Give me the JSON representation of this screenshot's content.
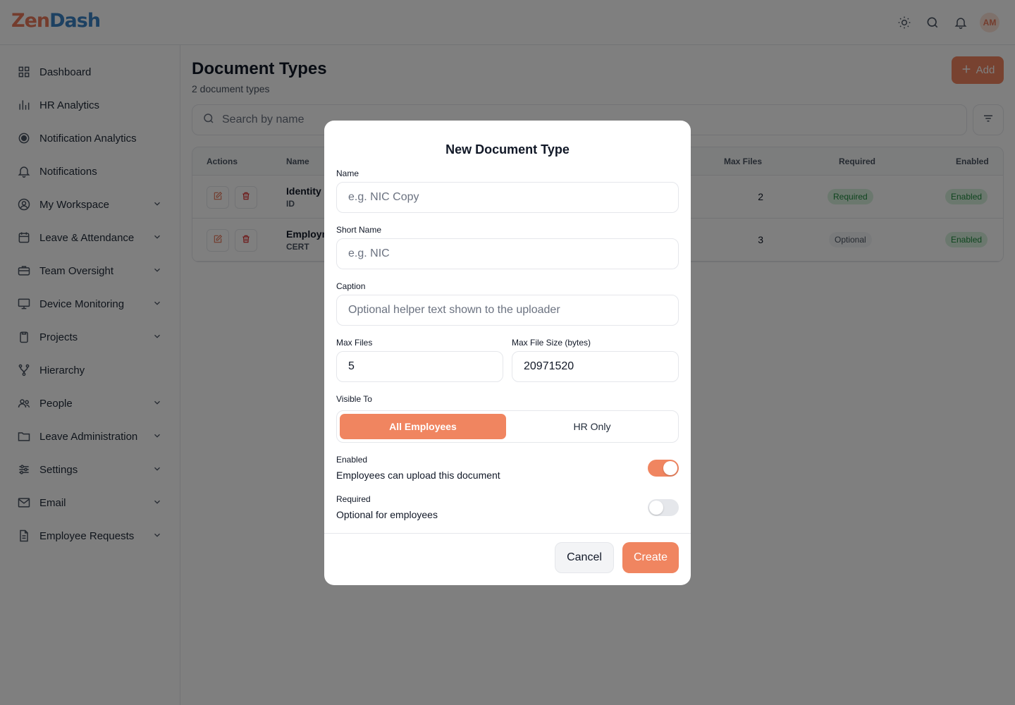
{
  "app": {
    "logo_part1": "Zen",
    "logo_part2": "Dash",
    "avatar_initials": "AM",
    "accent_color": "#f08560"
  },
  "topbar": {
    "icons": [
      "sun-icon",
      "search-icon",
      "bell-icon"
    ]
  },
  "sidebar": {
    "items": [
      {
        "label": "Dashboard",
        "icon": "grid-icon",
        "expandable": false
      },
      {
        "label": "HR Analytics",
        "icon": "bar-chart-icon",
        "expandable": false
      },
      {
        "label": "Notification Analytics",
        "icon": "target-icon",
        "expandable": false
      },
      {
        "label": "Notifications",
        "icon": "bell-icon",
        "expandable": false
      },
      {
        "label": "My Workspace",
        "icon": "user-circle-icon",
        "expandable": true
      },
      {
        "label": "Leave & Attendance",
        "icon": "calendar-icon",
        "expandable": true
      },
      {
        "label": "Team Oversight",
        "icon": "briefcase-icon",
        "expandable": true
      },
      {
        "label": "Device Monitoring",
        "icon": "monitor-icon",
        "expandable": true
      },
      {
        "label": "Projects",
        "icon": "clipboard-icon",
        "expandable": true
      },
      {
        "label": "Hierarchy",
        "icon": "hierarchy-icon",
        "expandable": false
      },
      {
        "label": "People",
        "icon": "users-icon",
        "expandable": true
      },
      {
        "label": "Leave Administration",
        "icon": "folder-icon",
        "expandable": true
      },
      {
        "label": "Settings",
        "icon": "sliders-icon",
        "expandable": true
      },
      {
        "label": "Email",
        "icon": "mail-icon",
        "expandable": true
      },
      {
        "label": "Employee Requests",
        "icon": "document-icon",
        "expandable": true
      }
    ]
  },
  "page": {
    "title": "Document Types",
    "subtitle": "2 document types",
    "add_label": "Add",
    "search_placeholder": "Search by name"
  },
  "table": {
    "headers": {
      "actions": "Actions",
      "name": "Name",
      "max_files": "Max Files",
      "required": "Required",
      "enabled": "Enabled"
    },
    "rows": [
      {
        "name": "Identity",
        "short": "ID",
        "max_files": "2",
        "required": "Required",
        "enabled": "Enabled"
      },
      {
        "name": "Employm",
        "short": "CERT",
        "max_files": "3",
        "required": "Optional",
        "enabled": "Enabled"
      }
    ]
  },
  "modal": {
    "title": "New Document Type",
    "name_label": "Name",
    "name_placeholder": "e.g. NIC Copy",
    "short_label": "Short Name",
    "short_placeholder": "e.g. NIC",
    "caption_label": "Caption",
    "caption_placeholder": "Optional helper text shown to the uploader",
    "max_files_label": "Max Files",
    "max_files_value": "5",
    "max_size_label": "Max File Size (bytes)",
    "max_size_value": "20971520",
    "visible_label": "Visible To",
    "visible_options": [
      "All Employees",
      "HR Only"
    ],
    "visible_selected": "All Employees",
    "enabled_title": "Enabled",
    "enabled_desc": "Employees can upload this document",
    "enabled_on": true,
    "required_title": "Required",
    "required_desc": "Optional for employees",
    "required_on": false,
    "cancel_label": "Cancel",
    "create_label": "Create"
  }
}
